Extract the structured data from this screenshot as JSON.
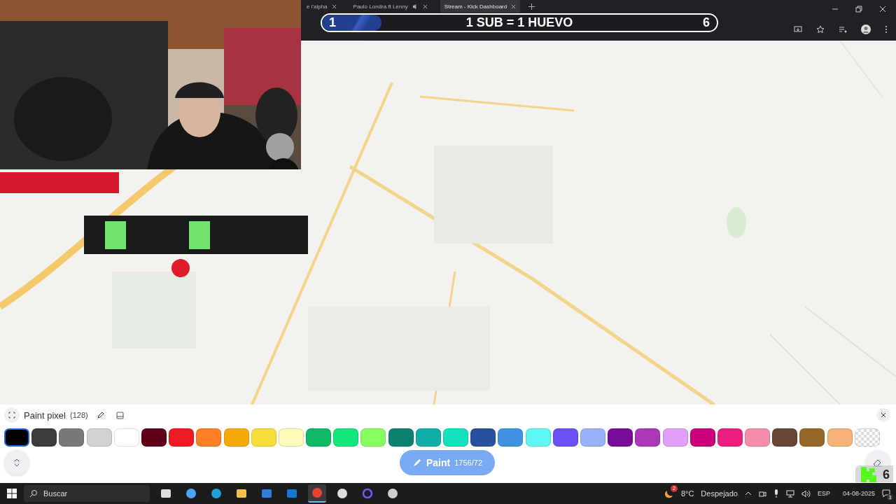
{
  "browser": {
    "tabs": [
      {
        "title": "e l'alpha",
        "selected": false,
        "muted": false
      },
      {
        "title": "Paulo Londra ft Lenny",
        "selected": false,
        "muted": true
      },
      {
        "title": "Stream - Kick Dashboard",
        "selected": true,
        "muted": false
      }
    ]
  },
  "goal_overlay": {
    "current": "1",
    "text": "1 SUB = 1 HUEVO",
    "target": "6",
    "level": 0.15
  },
  "paint_panel": {
    "title": "Paint pixel",
    "count": "(128)",
    "palette": [
      {
        "color": "#000000",
        "selected": true
      },
      {
        "color": "#3c3c3c",
        "selected": false
      },
      {
        "color": "#787878",
        "selected": false
      },
      {
        "color": "#d2d2d2",
        "selected": false
      },
      {
        "color": "#ffffff",
        "selected": false
      },
      {
        "color": "#600018",
        "selected": false
      },
      {
        "color": "#ed1c24",
        "selected": false
      },
      {
        "color": "#ff7f27",
        "selected": false
      },
      {
        "color": "#f6aa09",
        "selected": false
      },
      {
        "color": "#f9dd3b",
        "selected": false
      },
      {
        "color": "#fffabc",
        "selected": false
      },
      {
        "color": "#0eb968",
        "selected": false
      },
      {
        "color": "#13e67b",
        "selected": false
      },
      {
        "color": "#87ff5e",
        "selected": false
      },
      {
        "color": "#0c816e",
        "selected": false
      },
      {
        "color": "#10aea6",
        "selected": false
      },
      {
        "color": "#13e1be",
        "selected": false
      },
      {
        "color": "#28509e",
        "selected": false
      },
      {
        "color": "#4093e4",
        "selected": false
      },
      {
        "color": "#60f7f2",
        "selected": false
      },
      {
        "color": "#6b50f6",
        "selected": false
      },
      {
        "color": "#99b1fb",
        "selected": false
      },
      {
        "color": "#780c99",
        "selected": false
      },
      {
        "color": "#aa38b9",
        "selected": false
      },
      {
        "color": "#e09ff9",
        "selected": false
      },
      {
        "color": "#cb007a",
        "selected": false
      },
      {
        "color": "#ec1f80",
        "selected": false
      },
      {
        "color": "#f38da9",
        "selected": false
      },
      {
        "color": "#684634",
        "selected": false
      },
      {
        "color": "#95682a",
        "selected": false
      },
      {
        "color": "#f8b277",
        "selected": false
      },
      {
        "kind": "transparent",
        "selected": false
      }
    ],
    "paint_button": {
      "label": "Paint",
      "charges": "1756/72"
    }
  },
  "kick_badge": {
    "count": "6"
  },
  "taskbar": {
    "search_placeholder": "Buscar",
    "apps": [
      {
        "kind": "taskview",
        "active": false
      },
      {
        "kind": "copilot",
        "active": false
      },
      {
        "kind": "edge",
        "active": false
      },
      {
        "kind": "files",
        "active": false
      },
      {
        "kind": "store",
        "active": false
      },
      {
        "kind": "outlook",
        "active": false
      },
      {
        "kind": "chrome",
        "active": true
      },
      {
        "kind": "settings",
        "active": false
      },
      {
        "kind": "ring",
        "active": false
      },
      {
        "kind": "recorder",
        "active": false
      }
    ],
    "weather": {
      "badge": "2",
      "temp": "8°C",
      "condition": "Despejado"
    },
    "language": "ESP",
    "date": "04-08-2025",
    "notifications": "3"
  }
}
